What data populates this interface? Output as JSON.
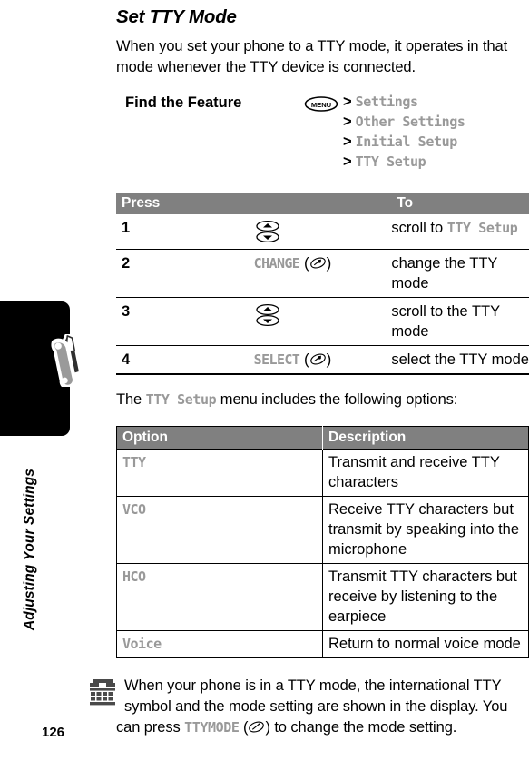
{
  "page": {
    "number": "126",
    "chapter_label": "Adjusting Your Settings",
    "title": "Set TTY Mode"
  },
  "intro": {
    "paragraph": "When you set your phone to a TTY mode, it operates in that mode whenever the TTY device is connected."
  },
  "find_feature": {
    "label": "Find the Feature",
    "menu_key": "MENU",
    "path": [
      {
        "sep": ">",
        "item": "Settings"
      },
      {
        "sep": ">",
        "item": "Other Settings"
      },
      {
        "sep": ">",
        "item": "Initial Setup"
      },
      {
        "sep": ">",
        "item": "TTY Setup"
      }
    ]
  },
  "steps_table": {
    "headers": {
      "press": "Press",
      "to": "To"
    },
    "rows": [
      {
        "num": "1",
        "key_icon": "nav-updown-key-icon",
        "key_label": "",
        "desc_pre": "scroll to ",
        "desc_code": "TTY Setup",
        "desc_post": ""
      },
      {
        "num": "2",
        "key_icon": "soft-key-icon",
        "key_label": "CHANGE",
        "desc_pre": "change the TTY mode",
        "desc_code": "",
        "desc_post": ""
      },
      {
        "num": "3",
        "key_icon": "nav-updown-key-icon",
        "key_label": "",
        "desc_pre": "scroll to the TTY mode",
        "desc_code": "",
        "desc_post": ""
      },
      {
        "num": "4",
        "key_icon": "soft-key-icon",
        "key_label": "SELECT",
        "desc_pre": "select the TTY mode",
        "desc_code": "",
        "desc_post": ""
      }
    ]
  },
  "options_intro": {
    "pre": "The ",
    "code": "TTY Setup",
    "post": " menu includes the following options:"
  },
  "options_table": {
    "headers": {
      "option": "Option",
      "description": "Description"
    },
    "rows": [
      {
        "option": "TTY",
        "description": "Transmit and receive TTY characters"
      },
      {
        "option": "VCO",
        "description": "Receive TTY characters but transmit by speaking into the microphone"
      },
      {
        "option": "HCO",
        "description": "Transmit TTY characters but receive by listening to the earpiece"
      },
      {
        "option": "Voice",
        "description": "Return to normal voice mode"
      }
    ]
  },
  "note": {
    "icon": "tty-symbol-icon",
    "text_pre": "When your phone is in a TTY mode, the international TTY symbol and the mode setting are shown in the display. You can press ",
    "code": "TTYMODE",
    "text_mid": " (",
    "text_post": ") to change the mode setting."
  },
  "colors": {
    "header_gray": "#808080",
    "display_text_gray": "#999999",
    "tab_black": "#000000",
    "tool_icon_gray": "#9a9a9a"
  }
}
